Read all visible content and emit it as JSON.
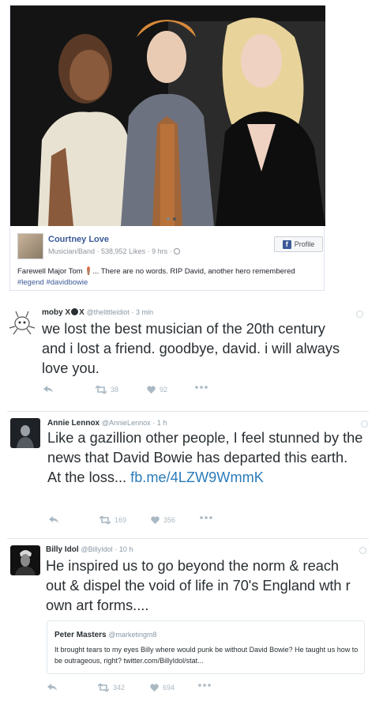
{
  "facebook_post": {
    "page_name": "Courtney Love",
    "meta": "Musician/Band · 538,952 Likes · 9 hrs ·",
    "profile_button": "Profile",
    "text_before": "Farewell Major Tom ",
    "text_after": "... There are no words. RIP David, another hero remembered ",
    "hashtag1": "#legend",
    "hashtag2": "#davidbowie"
  },
  "tweets": [
    {
      "name": "moby X",
      "name_mid": "X",
      "handle": "@thelittleidiot",
      "time": "· 3 min",
      "text": "we lost the best musician of the 20th century and i lost a friend. goodbye, david. i will always love you.",
      "retweets": "38",
      "likes": "92"
    },
    {
      "name": "Annie Lennox",
      "handle": "@AnnieLennox",
      "time": "· 1 h",
      "text": "Like a gazillion other people, I feel stunned by the news that David Bowie has departed this earth.",
      "text_line2": "At the loss... ",
      "link": "fb.me/4LZW9WmmK",
      "retweets": "169",
      "likes": "356"
    },
    {
      "name": "Billy Idol",
      "handle": "@BillyIdol",
      "time": "· 10 h",
      "text": "He inspired us to go beyond the norm & reach out & dispel the void of life in 70's England wth r own art forms....",
      "retweets": "342",
      "likes": "694",
      "quote": {
        "name": "Peter Masters",
        "handle": "@marketingm8",
        "text": "It brought tears to my eyes Billy where would punk be without David Bowie? He taught us how to be outrageous, right? twitter.com/BillyIdol/stat..."
      }
    }
  ]
}
